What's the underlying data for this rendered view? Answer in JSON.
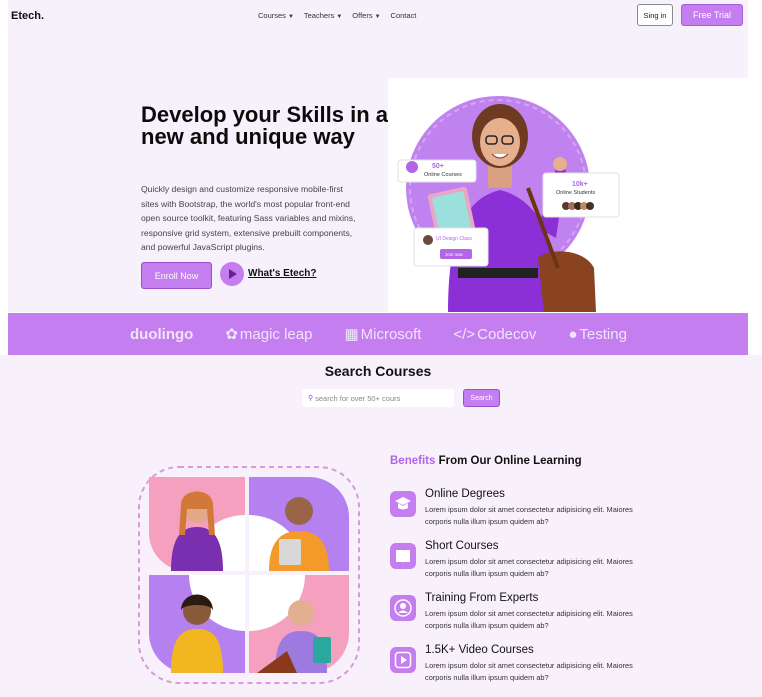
{
  "nav": {
    "brand": "Etech.",
    "items": [
      {
        "label": "Courses",
        "caret": true
      },
      {
        "label": "Teachers",
        "caret": true
      },
      {
        "label": "Offers",
        "caret": true
      },
      {
        "label": "Contact",
        "caret": false
      }
    ],
    "signin_label": "Sing in",
    "trial_label": "Free Trial"
  },
  "hero": {
    "title": "Develop your Skills in a new and unique way",
    "text": "Quickly design and customize responsive mobile-first sites with Bootstrap, the world's most popular front-end open source toolkit, featuring Sass variables and mixins, responsive grid system, extensive prebuilt components, and powerful JavaScript plugins.",
    "enroll_label": "Enroll Now",
    "whats_label": "What's Etech?",
    "cards": {
      "courses_count": "50+",
      "courses_label": "Online Courses",
      "students_count": "10k+",
      "students_label": "Online Students",
      "design_class": "UI Design Class",
      "join_label": "Join now"
    }
  },
  "partners": [
    {
      "name": "duolingo",
      "glyph": "",
      "bold": true
    },
    {
      "name": "magic leap",
      "glyph": "✿",
      "bold": false
    },
    {
      "name": "Microsoft",
      "glyph": "▦",
      "bold": false
    },
    {
      "name": "Codecov",
      "glyph": "</>",
      "bold": false
    },
    {
      "name": "Testing",
      "glyph": "●",
      "bold": false
    }
  ],
  "search": {
    "title": "Search Courses",
    "placeholder": "search for over 50+ cours",
    "button_label": "Search"
  },
  "benefits": {
    "title_highlight": "Benefits",
    "title_rest": " From Our Online Learning",
    "items": [
      {
        "icon": "graduation-cap-icon",
        "title": "Online Degrees",
        "text": "Lorem ipsum dolor sit amet consectetur adipisicing elit. Maiores corporis nulla illum ipsum quidem ab?"
      },
      {
        "icon": "book-icon",
        "title": "Short Courses",
        "text": "Lorem ipsum dolor sit amet consectetur adipisicing elit. Maiores corporis nulla illum ipsum quidem ab?"
      },
      {
        "icon": "user-icon",
        "title": "Training From Experts",
        "text": "Lorem ipsum dolor sit amet consectetur adipisicing elit. Maiores corporis nulla illum ipsum quidem ab?"
      },
      {
        "icon": "play-icon",
        "title": "1.5K+ Video Courses",
        "text": "Lorem ipsum dolor sit amet consectetur adipisicing elit. Maiores corporis nulla illum ipsum quidem ab?"
      }
    ]
  },
  "colors": {
    "accent": "#c57ef0",
    "accent_dark": "#9c4ed0",
    "hero_bg": "#f7f1fb"
  }
}
